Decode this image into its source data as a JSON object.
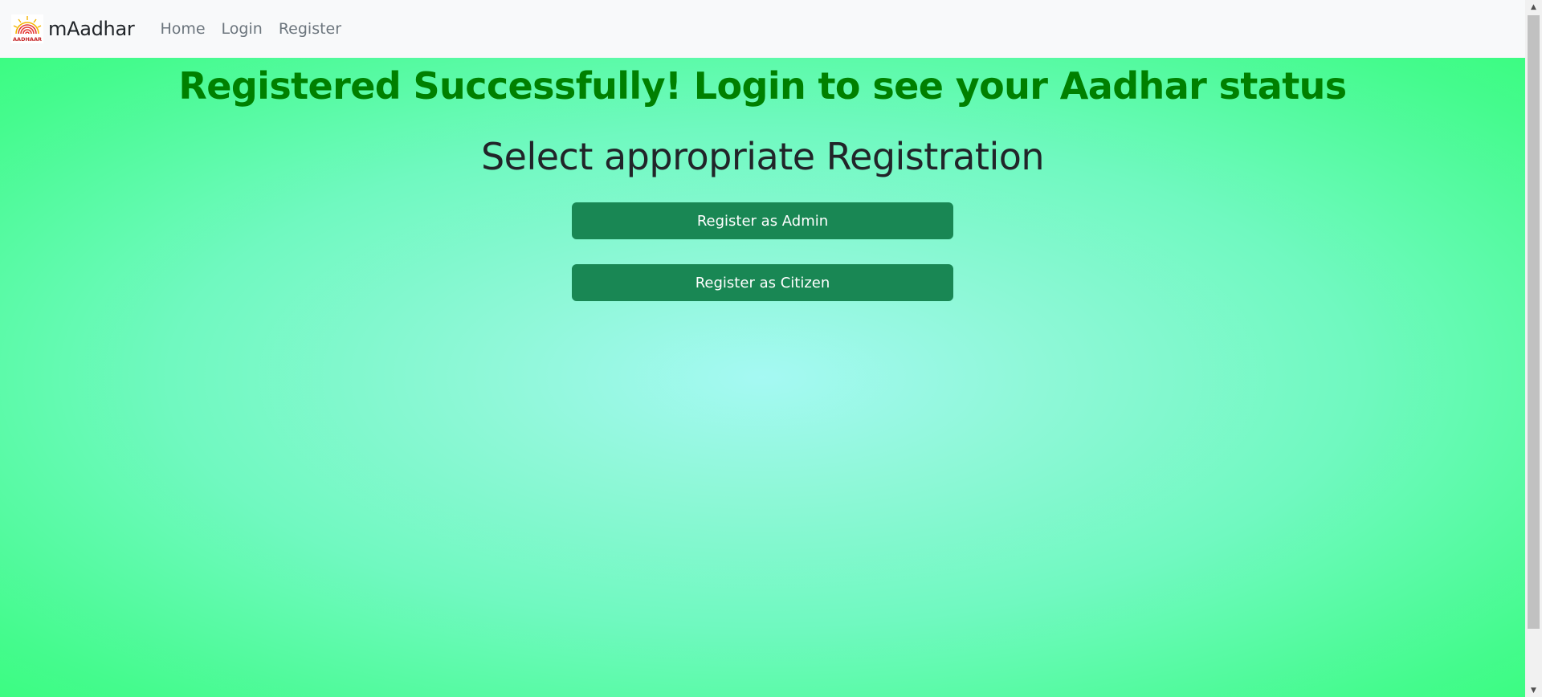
{
  "navbar": {
    "brand_name": "mAadhar",
    "logo_text": "AADHAAR",
    "links": [
      "Home",
      "Login",
      "Register"
    ]
  },
  "main": {
    "success_message": "Registered Successfully! Login to see your Aadhar status",
    "heading": "Select appropriate Registration",
    "buttons": {
      "admin": "Register as Admin",
      "citizen": "Register as Citizen"
    }
  },
  "colors": {
    "success_text": "#008000",
    "button_bg": "#198754",
    "navbar_bg": "#f8f9fa"
  }
}
